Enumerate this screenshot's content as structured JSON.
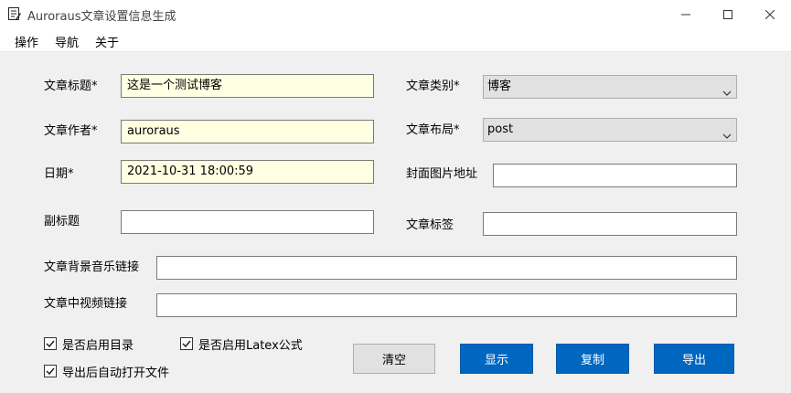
{
  "window": {
    "title": "Auroraus文章设置信息生成",
    "controls": {
      "minimize": "minimize-icon",
      "maximize": "maximize-icon",
      "close": "close-icon"
    }
  },
  "menu": {
    "items": [
      {
        "label": "操作"
      },
      {
        "label": "导航"
      },
      {
        "label": "关于"
      }
    ]
  },
  "form": {
    "title_label": "文章标题*",
    "title_value": "这是一个测试博客",
    "author_label": "文章作者*",
    "author_value": "auroraus",
    "date_label": "日期*",
    "date_value": "2021-10-31 18:00:59",
    "subtitle_label": "副标题",
    "subtitle_value": "",
    "category_label": "文章类别*",
    "category_value": "博客",
    "layout_label": "文章布局*",
    "layout_value": "post",
    "cover_label": "封面图片地址",
    "cover_value": "",
    "tags_label": "文章标签",
    "tags_value": "",
    "music_label": "文章背景音乐链接",
    "music_value": "",
    "video_label": "文章中视频链接",
    "video_value": ""
  },
  "options": {
    "toc_label": "是否启用目录",
    "toc_checked": true,
    "latex_label": "是否启用Latex公式",
    "latex_checked": true,
    "autoopen_label": "导出后自动打开文件",
    "autoopen_checked": true
  },
  "buttons": {
    "clear": "清空",
    "show": "显示",
    "copy": "复制",
    "export": "导出"
  },
  "colors": {
    "required_field_bg": "#ffffe1",
    "primary_button": "#0067c0",
    "window_bg": "#f0f0f0"
  }
}
